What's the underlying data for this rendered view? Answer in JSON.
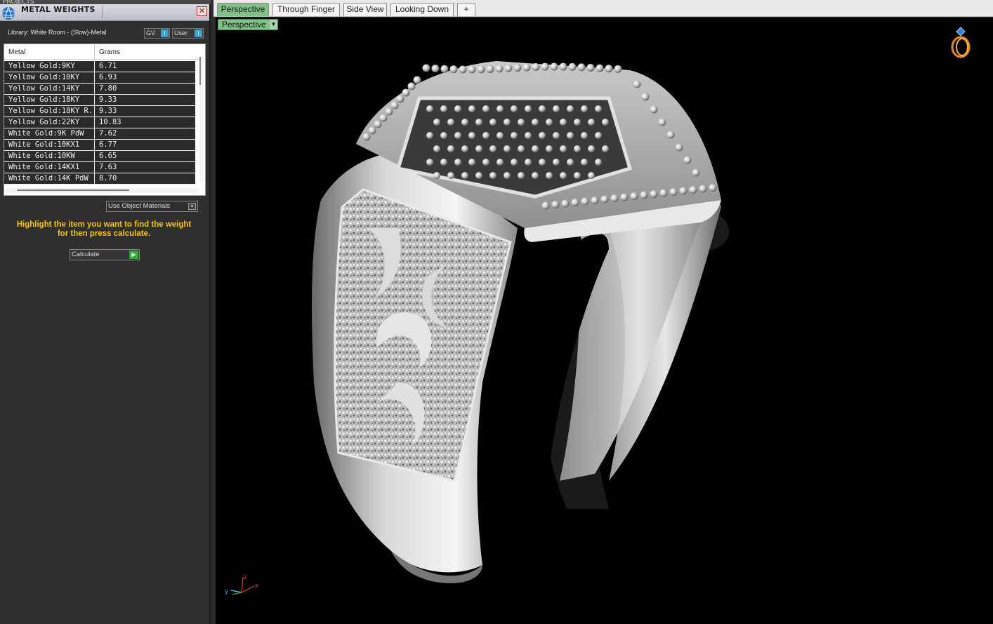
{
  "left_panel": {
    "projects_label": "PROJECTS",
    "title": "METAL WEIGHTS",
    "library": "Library: White Room - (Slow)-Metal",
    "gv_label": "GV",
    "user_label": "User",
    "columns": [
      "Metal",
      "Grams"
    ],
    "rows": [
      {
        "metal": "Yellow Gold:9KY",
        "grams": "6.71"
      },
      {
        "metal": "Yellow Gold:10KY",
        "grams": "6.93"
      },
      {
        "metal": "Yellow Gold:14KY",
        "grams": "7.80"
      },
      {
        "metal": "Yellow Gold:18KY",
        "grams": "9.33"
      },
      {
        "metal": "Yellow Gold:18KY R...",
        "grams": "9.33"
      },
      {
        "metal": "Yellow Gold:22KY",
        "grams": "10.83"
      },
      {
        "metal": "White Gold:9K PdW",
        "grams": "7.62"
      },
      {
        "metal": "White Gold:10KX1",
        "grams": "6.77"
      },
      {
        "metal": "White Gold:10KW",
        "grams": "6.65"
      },
      {
        "metal": "White Gold:14KX1",
        "grams": "7.63"
      },
      {
        "metal": "White Gold:14K PdW",
        "grams": "8.70"
      }
    ],
    "use_object_materials": "Use Object Materials",
    "hint_line1": "Highlight the item you want to find the weight",
    "hint_line2": "for then press calculate.",
    "calculate_label": "Calculate"
  },
  "viewport": {
    "tabs": [
      "Perspective",
      "Through Finger",
      "Side View",
      "Looking Down"
    ],
    "active_tab": "Perspective",
    "add_tab_label": "+",
    "view_selector": "Perspective",
    "axis_labels": {
      "z": "z",
      "x": "x",
      "y": "y"
    }
  }
}
